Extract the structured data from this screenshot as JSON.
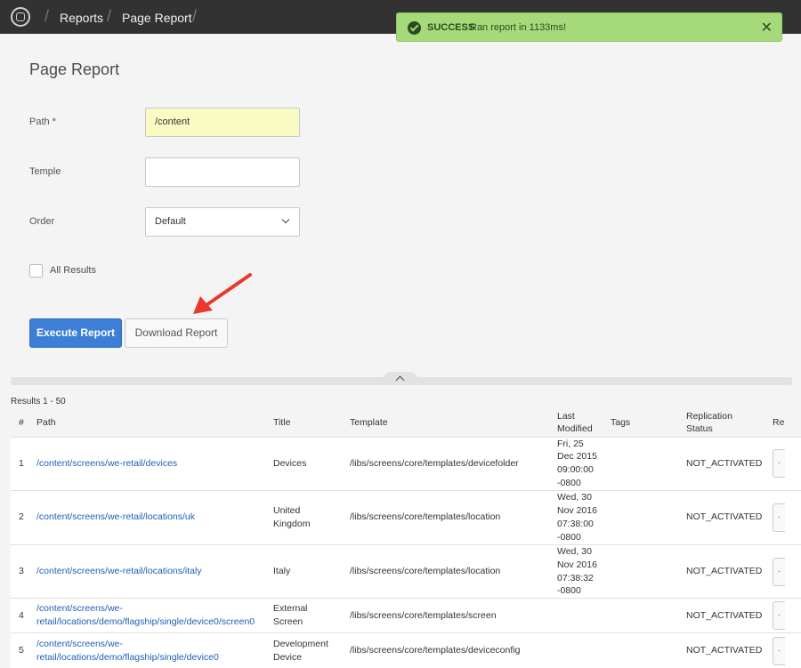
{
  "header": {
    "breadcrumbs": [
      "Reports",
      "Page Report"
    ]
  },
  "toast": {
    "title": "SUCCESS",
    "message": "Ran report in 1133ms!",
    "close": "✕"
  },
  "form": {
    "title": "Page Report",
    "path_label": "Path *",
    "path_value": "/content",
    "template_label": "Temple",
    "template_value": "",
    "order_label": "Order",
    "order_value": "Default",
    "all_results_label": "All Results",
    "execute_label": "Execute Report",
    "download_label": "Download Report"
  },
  "results": {
    "summary": "Results 1 - 50",
    "columns": [
      "#",
      "Path",
      "Title",
      "Template",
      "Last\nModified",
      "Tags",
      "Replication\nStatus",
      "Re"
    ],
    "rows": [
      {
        "num": "1",
        "path": "/content/screens/we-retail/devices",
        "title": "Devices",
        "template": "/libs/screens/core/templates/devicefolder",
        "modified": "Fri, 25\nDec 2015\n09:00:00\n-0800",
        "tags": "",
        "status": "NOT_ACTIVATED"
      },
      {
        "num": "2",
        "path": "/content/screens/we-retail/locations/uk",
        "title": "United\nKingdom",
        "template": "/libs/screens/core/templates/location",
        "modified": "Wed, 30\nNov 2016\n07:38:00\n-0800",
        "tags": "",
        "status": "NOT_ACTIVATED"
      },
      {
        "num": "3",
        "path": "/content/screens/we-retail/locations/italy",
        "title": "Italy",
        "template": "/libs/screens/core/templates/location",
        "modified": "Wed, 30\nNov 2016\n07:38:32\n-0800",
        "tags": "",
        "status": "NOT_ACTIVATED"
      },
      {
        "num": "4",
        "path": "/content/screens/we-\nretail/locations/demo/flagship/single/device0/screen0",
        "title": "External\nScreen",
        "template": "/libs/screens/core/templates/screen",
        "modified": "",
        "tags": "",
        "status": "NOT_ACTIVATED"
      },
      {
        "num": "5",
        "path": "/content/screens/we-\nretail/locations/demo/flagship/single/device0",
        "title": "Development\nDevice",
        "template": "/libs/screens/core/templates/deviceconfig",
        "modified": "",
        "tags": "",
        "status": "NOT_ACTIVATED"
      }
    ]
  },
  "colors": {
    "topbar": "#323232",
    "toast": "#a5d97a",
    "primary": "#3d7fd6",
    "link": "#2060b4",
    "highlight_field": "#fafbc3",
    "arrow": "#e8392b"
  }
}
